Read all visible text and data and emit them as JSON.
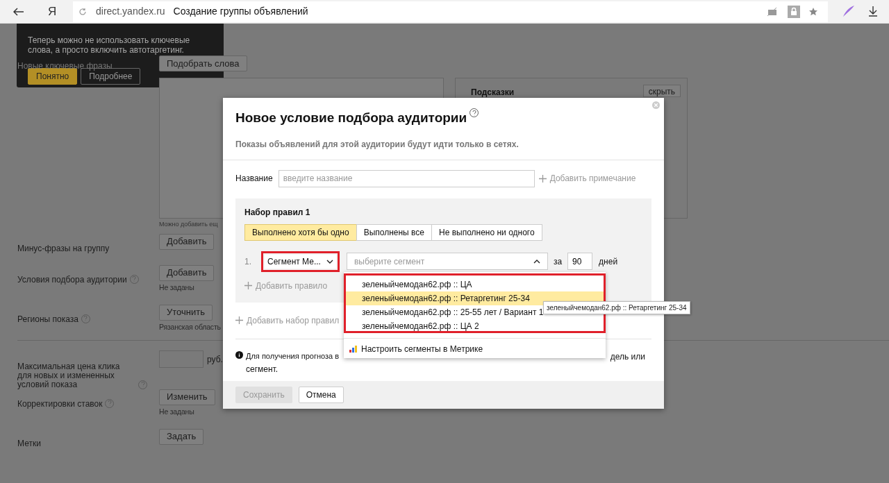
{
  "browser": {
    "logo": "Я",
    "domain": "direct.yandex.ru",
    "title": "Создание группы объявлений"
  },
  "page": {
    "keywords_label": "Новые ключевые фразы",
    "pick_words_button": "Подобрать слова",
    "keywords_hint": "Можно добавить ещ",
    "hints_panel": {
      "title": "Подсказки",
      "hide_button": "скрыть"
    },
    "rows": [
      {
        "label": "Минус-фразы на группу",
        "help": false,
        "button": "Добавить"
      },
      {
        "label": "Условия подбора аудитории",
        "help": true,
        "button": "Добавить",
        "note": "Не заданы"
      },
      {
        "label": "Регионы показа",
        "help": true,
        "button": "Уточнить",
        "note": "Рязанская область"
      }
    ],
    "price": {
      "label": "Максимальная цена клика для новых и измененных условий показа",
      "help": true,
      "unit": "руб."
    },
    "rows2": [
      {
        "label": "Корректировки ставок",
        "help": true,
        "button": "Изменить",
        "note": "Не заданы"
      },
      {
        "label": "Метки",
        "help": false,
        "button": "Задать"
      }
    ]
  },
  "tip": {
    "text": "Теперь можно не использовать ключевые слова, а просто включить автотаргетинг.",
    "buttons": [
      {
        "label": "Понятно",
        "primary": true
      },
      {
        "label": "Подробнее",
        "primary": false
      }
    ]
  },
  "modal": {
    "title": "Новое условие подбора аудитории",
    "subtitle": "Показы объявлений для этой аудитории будут идти только в сетях.",
    "name_label": "Название",
    "name_placeholder": "введите название",
    "add_note": "Добавить примечание",
    "ruleset": {
      "title": "Набор правил 1",
      "modes": [
        {
          "label": "Выполнено хотя бы одно",
          "selected": true
        },
        {
          "label": "Выполнены все",
          "selected": false
        },
        {
          "label": "Не выполнено ни одного",
          "selected": false
        }
      ],
      "rule": {
        "number": "1.",
        "type": "Сегмент Ме...",
        "segment_placeholder": "выберите сегмент",
        "expanded": true,
        "for": "за",
        "days_value": "90",
        "days": "дней"
      },
      "add_rule": "Добавить правило"
    },
    "add_ruleset": "Добавить набор правил",
    "note_left": "Для получения прогноза в",
    "note_right": "дель или",
    "note_end": "сегмент.",
    "dropdown": {
      "options": [
        {
          "label": "зеленыйчемодан62.рф :: ЦА",
          "selected": false
        },
        {
          "label": "зеленыйчемодан62.рф :: Ретаргетинг 25-34",
          "selected": true
        },
        {
          "label": "зеленыйчемодан62.рф :: 25-55 лет / Вариант 1",
          "selected": false
        },
        {
          "label": "зеленыйчемодан62.рф :: ЦА 2",
          "selected": false
        }
      ],
      "metrika_link": "Настроить сегменты в Метрике"
    },
    "tooltip": "зеленыйчемодан62.рф :: Ретаргетинг 25-34",
    "buttons": [
      {
        "label": "Сохранить",
        "disabled": true
      },
      {
        "label": "Отмена",
        "disabled": false
      }
    ]
  }
}
